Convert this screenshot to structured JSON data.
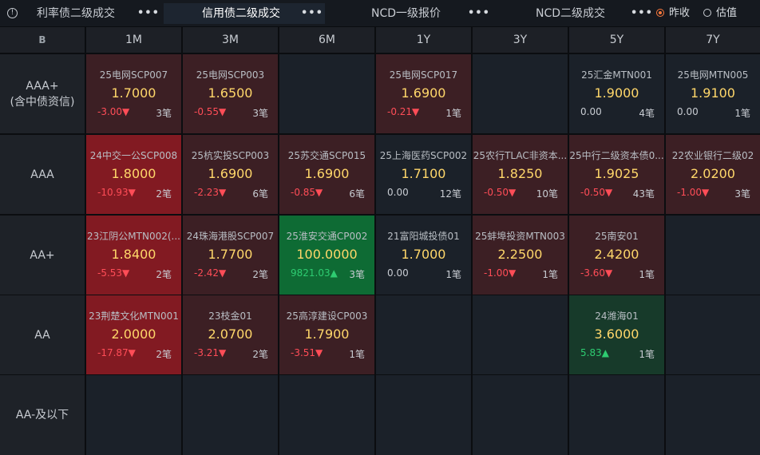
{
  "tabs": [
    {
      "label": "利率债二级成交",
      "more": "•••"
    },
    {
      "label": "信用债二级成交",
      "more": "•••"
    },
    {
      "label": "NCD一级报价",
      "more": "•••"
    },
    {
      "label": "NCD二级成交",
      "more": "•••"
    }
  ],
  "options": {
    "prev_close": "昨收",
    "valuation": "估值"
  },
  "corner_label": "B",
  "columns": [
    "1M",
    "3M",
    "6M",
    "1Y",
    "3Y",
    "5Y",
    "7Y"
  ],
  "rows": [
    {
      "label_line1": "AAA+",
      "label_line2": "(含中债资信)"
    },
    {
      "label_line1": "AAA",
      "label_line2": ""
    },
    {
      "label_line1": "AA+",
      "label_line2": ""
    },
    {
      "label_line1": "AA",
      "label_line2": ""
    },
    {
      "label_line1": "AA-及以下",
      "label_line2": ""
    }
  ],
  "cells": {
    "r0c0": {
      "name": "25电网SCP007",
      "rate": "1.7000",
      "change": "-3.00▼",
      "count": "3笔"
    },
    "r0c1": {
      "name": "25电网SCP003",
      "rate": "1.6500",
      "change": "-0.55▼",
      "count": "3笔"
    },
    "r0c3": {
      "name": "25电网SCP017",
      "rate": "1.6900",
      "change": "-0.21▼",
      "count": "1笔"
    },
    "r0c5": {
      "name": "25汇金MTN001",
      "rate": "1.9000",
      "change": "0.00",
      "count": "4笔"
    },
    "r0c6": {
      "name": "25电网MTN005",
      "rate": "1.9100",
      "change": "0.00",
      "count": "1笔"
    },
    "r1c0": {
      "name": "24中交一公SCP008",
      "rate": "1.8000",
      "change": "-10.93▼",
      "count": "2笔"
    },
    "r1c1": {
      "name": "25杭实投SCP003",
      "rate": "1.6900",
      "change": "-2.23▼",
      "count": "6笔"
    },
    "r1c2": {
      "name": "25苏交通SCP015",
      "rate": "1.6900",
      "change": "-0.85▼",
      "count": "6笔"
    },
    "r1c3": {
      "name": "25上海医药SCP002",
      "rate": "1.7100",
      "change": "0.00",
      "count": "12笔"
    },
    "r1c4": {
      "name": "25农行TLAC非资本...",
      "rate": "1.8250",
      "change": "-0.50▼",
      "count": "10笔"
    },
    "r1c5": {
      "name": "25中行二级资本债0...",
      "rate": "1.9025",
      "change": "-0.50▼",
      "count": "43笔"
    },
    "r1c6": {
      "name": "22农业银行二级02",
      "rate": "2.0200",
      "change": "-1.00▼",
      "count": "3笔"
    },
    "r2c0": {
      "name": "23江阴公MTN002(...",
      "rate": "1.8400",
      "change": "-5.53▼",
      "count": "2笔"
    },
    "r2c1": {
      "name": "24珠海港股SCP007",
      "rate": "1.7700",
      "change": "-2.42▼",
      "count": "2笔"
    },
    "r2c2": {
      "name": "25淮安交通CP002",
      "rate": "100.0000",
      "change": "9821.03▲",
      "count": "3笔"
    },
    "r2c3": {
      "name": "21富阳城投债01",
      "rate": "1.7000",
      "change": "0.00",
      "count": "1笔"
    },
    "r2c4": {
      "name": "25蚌埠投资MTN003",
      "rate": "2.2500",
      "change": "-1.00▼",
      "count": "1笔"
    },
    "r2c5": {
      "name": "25南安01",
      "rate": "2.4200",
      "change": "-3.60▼",
      "count": "1笔"
    },
    "r3c0": {
      "name": "23荆楚文化MTN001",
      "rate": "2.0000",
      "change": "-17.87▼",
      "count": "2笔"
    },
    "r3c1": {
      "name": "23枝金01",
      "rate": "2.0700",
      "change": "-3.21▼",
      "count": "2笔"
    },
    "r3c2": {
      "name": "25高淳建设CP003",
      "rate": "1.7900",
      "change": "-3.51▼",
      "count": "1笔"
    },
    "r3c5": {
      "name": "24潍海01",
      "rate": "3.6000",
      "change": "5.83▲",
      "count": "1笔"
    }
  },
  "colors": {
    "accent_radio": "#ff7a3d",
    "down": "#ff4d57",
    "up": "#2ecc71",
    "rate": "#ffd76a"
  }
}
